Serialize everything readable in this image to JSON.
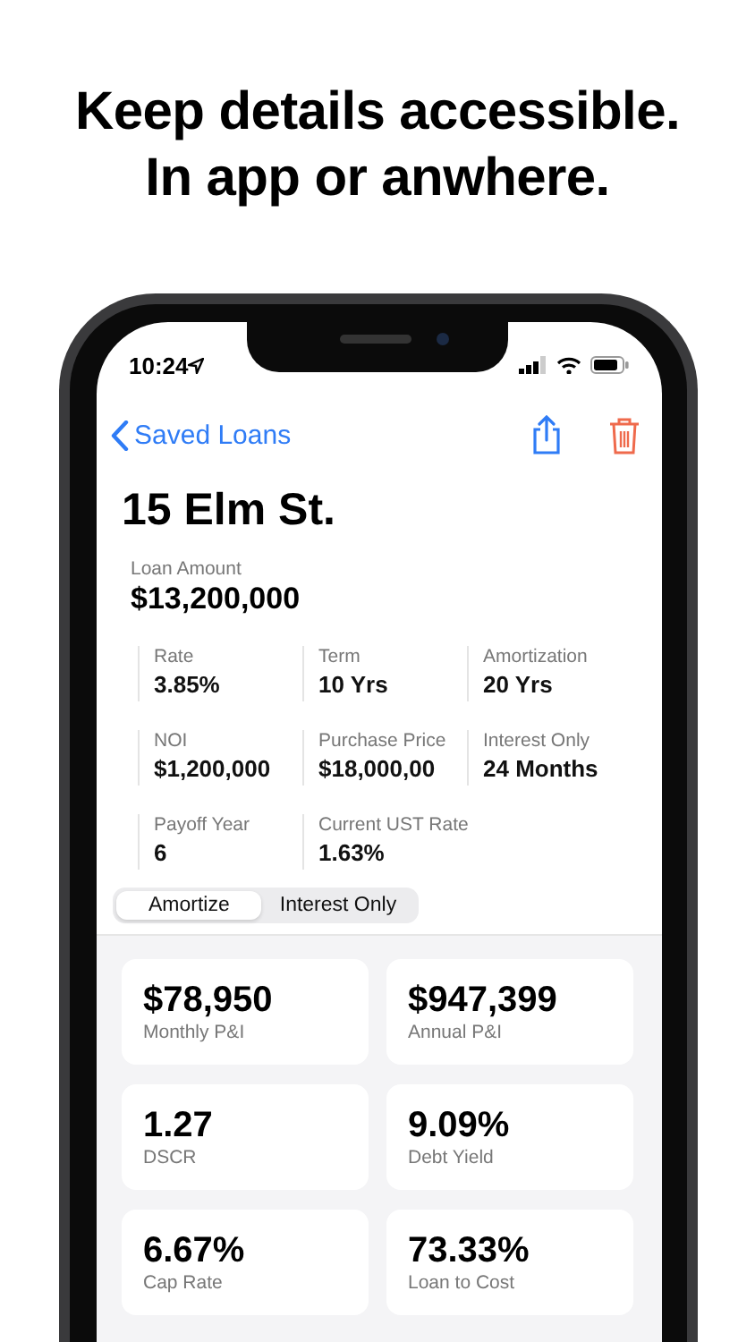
{
  "headline": "Keep details accessible. In app or anwhere.",
  "status_bar": {
    "time": "10:24"
  },
  "nav": {
    "back": "Saved Loans"
  },
  "title": "15 Elm St.",
  "loan_amount": {
    "label": "Loan Amount",
    "value": "$13,200,000"
  },
  "fields": [
    {
      "label": "Rate",
      "value": "3.85%"
    },
    {
      "label": "Term",
      "value": "10 Yrs"
    },
    {
      "label": "Amortization",
      "value": "20 Yrs"
    },
    {
      "label": "NOI",
      "value": "$1,200,000"
    },
    {
      "label": "Purchase Price",
      "value": "$18,000,00"
    },
    {
      "label": "Interest Only",
      "value": "24 Months"
    },
    {
      "label": "Payoff Year",
      "value": "6"
    },
    {
      "label": "Current UST Rate",
      "value": "1.63%"
    }
  ],
  "segments": [
    {
      "label": "Amortize",
      "selected": true
    },
    {
      "label": "Interest Only",
      "selected": false
    }
  ],
  "metrics": [
    {
      "value": "$78,950",
      "label": "Monthly P&I"
    },
    {
      "value": "$947,399",
      "label": "Annual P&I"
    },
    {
      "value": "1.27",
      "label": "DSCR"
    },
    {
      "value": "9.09%",
      "label": "Debt Yield"
    },
    {
      "value": "6.67%",
      "label": "Cap Rate"
    },
    {
      "value": "73.33%",
      "label": "Loan to Cost"
    }
  ]
}
